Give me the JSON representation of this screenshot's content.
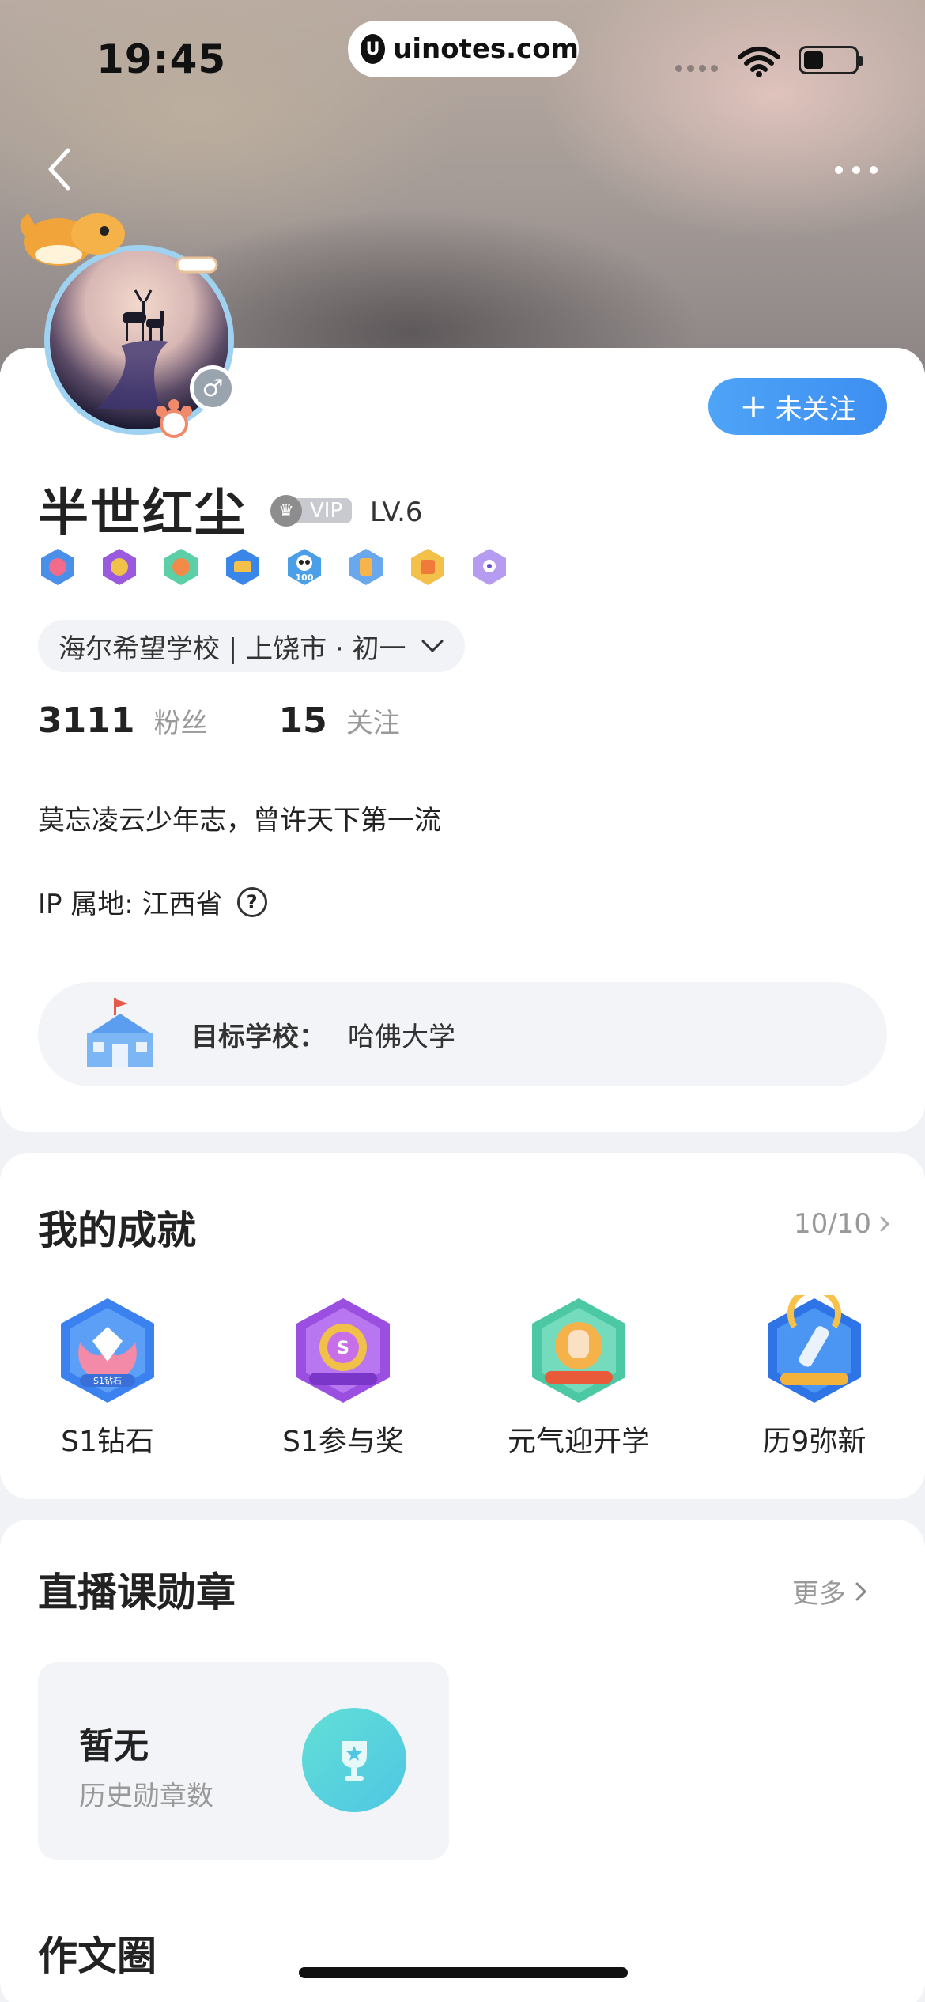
{
  "status_bar": {
    "time": "19:45",
    "url": "uinotes.com"
  },
  "profile": {
    "username": "半世红尘",
    "vip_label": "VIP",
    "level": "LV.6",
    "gender_symbol": "♂",
    "follow_label": "未关注",
    "school": "海尔希望学校 | 上饶市 · 初一",
    "fans_count": "3111",
    "fans_label": "粉丝",
    "following_count": "15",
    "following_label": "关注",
    "bio": "莫忘凌云少年志，曾许天下第一流",
    "ip_location": "IP 属地: 江西省",
    "target_school_label": "目标学校：",
    "target_school_value": "哈佛大学"
  },
  "badges": [
    "badge-1",
    "badge-2",
    "badge-3",
    "badge-4",
    "badge-100",
    "badge-6",
    "badge-7",
    "badge-8"
  ],
  "achievements": {
    "title": "我的成就",
    "progress": "10/10",
    "items": [
      {
        "label": "S1钻石",
        "icon": "diamond-medal-icon",
        "color": "#3b82f0"
      },
      {
        "label": "S1参与奖",
        "icon": "participation-medal-icon",
        "color": "#9b4fe0"
      },
      {
        "label": "元气迎开学",
        "icon": "school-start-medal-icon",
        "color": "#4cc9a4"
      },
      {
        "label": "历9弥新",
        "icon": "anniversary-medal-icon",
        "color": "#2e74e6"
      }
    ]
  },
  "live_medals": {
    "title": "直播课勋章",
    "more_label": "更多",
    "count": "暂无",
    "sub_label": "历史勋章数"
  },
  "essay_circle": {
    "title": "作文圈"
  }
}
